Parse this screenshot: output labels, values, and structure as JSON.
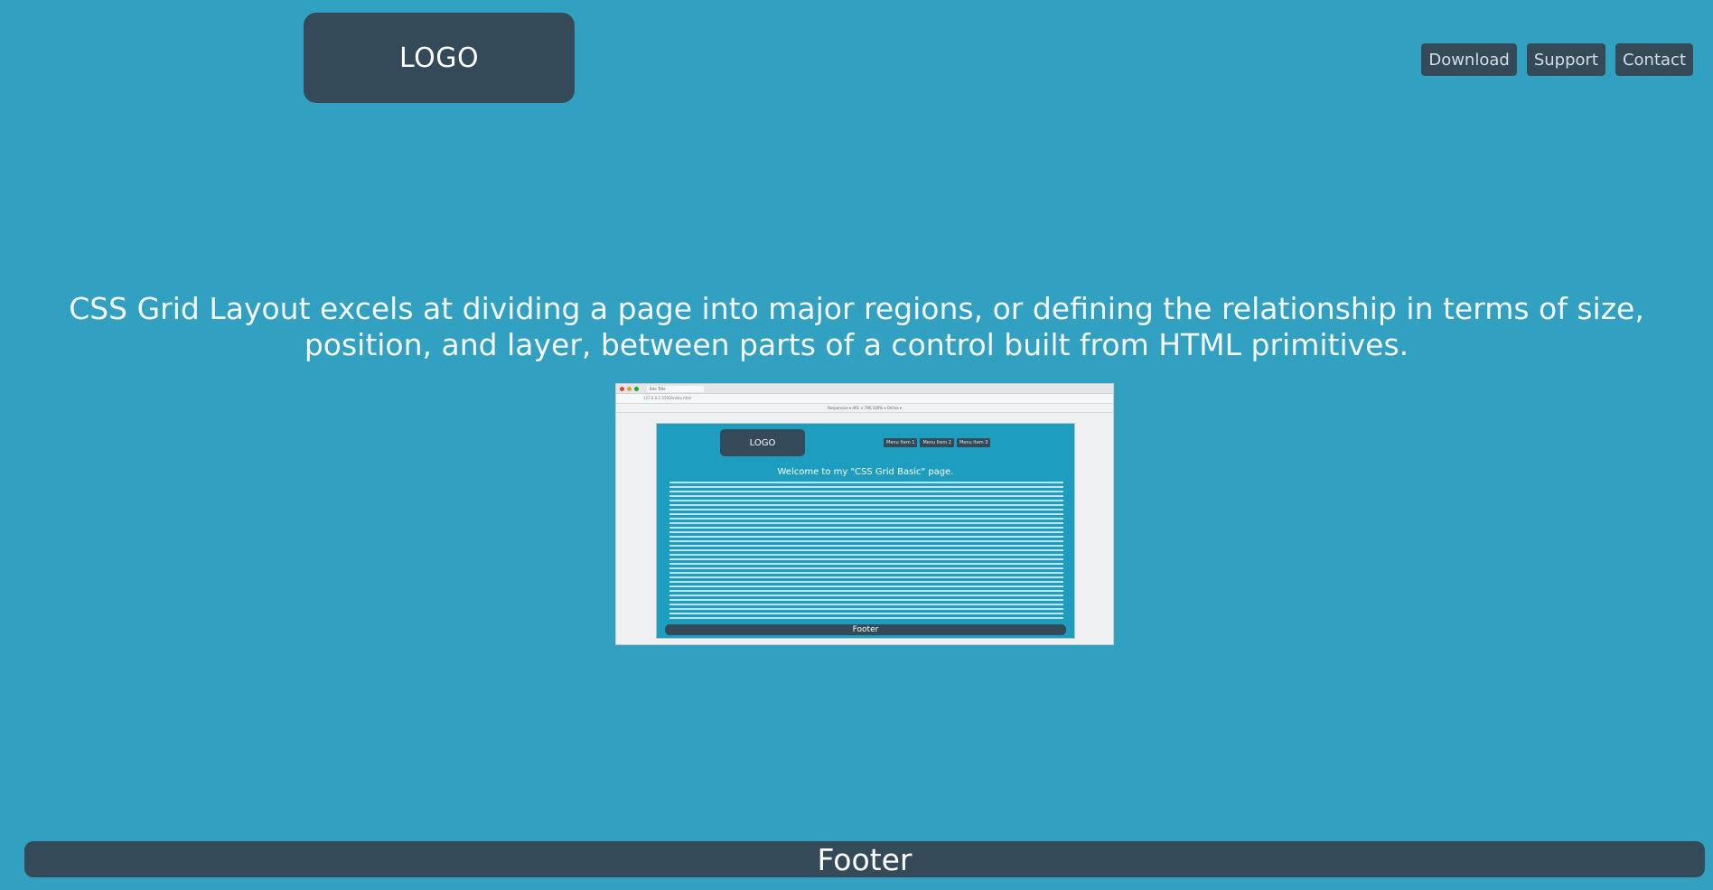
{
  "header": {
    "logo": "LOGO",
    "nav": [
      {
        "label": "Download"
      },
      {
        "label": "Support"
      },
      {
        "label": "Contact"
      }
    ]
  },
  "main": {
    "headline": "CSS Grid Layout excels at dividing a page into major regions, or defining the relationship in terms of size, position, and layer, between parts of a control built from HTML primitives."
  },
  "screenshot": {
    "tab_title": "Site Title",
    "url": "127.0.0.1:5500/index.html",
    "devtools": "Responsive ▾   491 × 786   100% ▾   Online ▾",
    "logo": "LOGO",
    "menu": [
      "Menu Item 1",
      "Menu Item 2",
      "Menu Item 3"
    ],
    "heading": "Welcome to my \"CSS Grid Basic\" page.",
    "footer": "Footer"
  },
  "footer": {
    "label": "Footer"
  },
  "colors": {
    "background": "#32a0c1",
    "panel": "#344a58",
    "text": "#f4f6f7"
  }
}
